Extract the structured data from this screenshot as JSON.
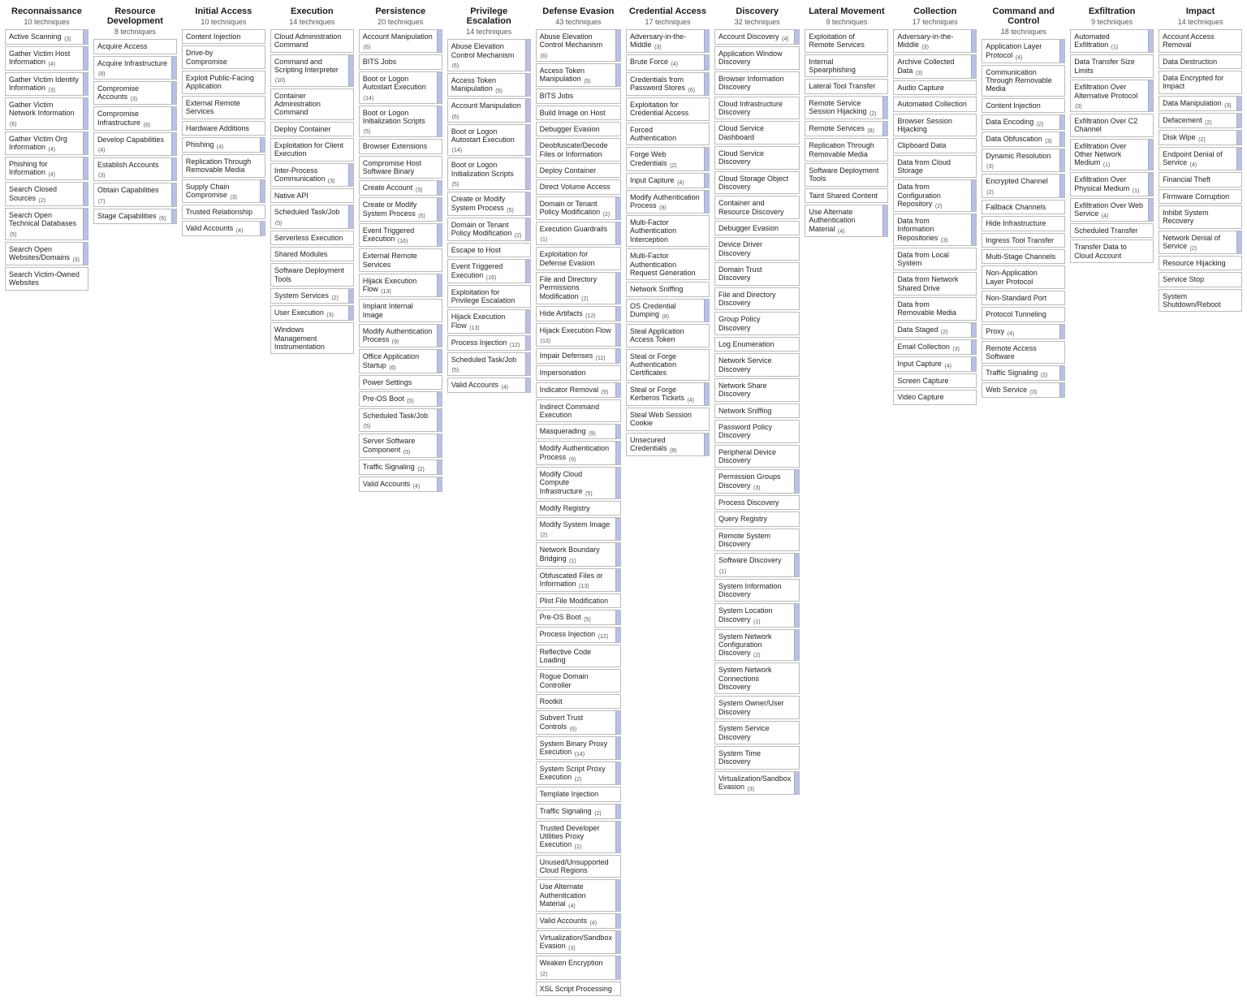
{
  "tactics": [
    {
      "name": "Reconnaissance",
      "count": 10,
      "techniques": [
        {
          "label": "Active Scanning",
          "sub": 3
        },
        {
          "label": "Gather Victim Host Information",
          "sub": 4
        },
        {
          "label": "Gather Victim Identity Information",
          "sub": 3
        },
        {
          "label": "Gather Victim Network Information",
          "sub": 6
        },
        {
          "label": "Gather Victim Org Information",
          "sub": 4
        },
        {
          "label": "Phishing for Information",
          "sub": 4
        },
        {
          "label": "Search Closed Sources",
          "sub": 2
        },
        {
          "label": "Search Open Technical Databases",
          "sub": 5
        },
        {
          "label": "Search Open Websites/Domains",
          "sub": 3
        },
        {
          "label": "Search Victim-Owned Websites"
        }
      ]
    },
    {
      "name": "Resource Development",
      "count": 8,
      "techniques": [
        {
          "label": "Acquire Access"
        },
        {
          "label": "Acquire Infrastructure",
          "sub": 8
        },
        {
          "label": "Compromise Accounts",
          "sub": 3
        },
        {
          "label": "Compromise Infrastructure",
          "sub": 8
        },
        {
          "label": "Develop Capabilities",
          "sub": 4
        },
        {
          "label": "Establish Accounts",
          "sub": 3
        },
        {
          "label": "Obtain Capabilities",
          "sub": 7
        },
        {
          "label": "Stage Capabilities",
          "sub": 6
        }
      ]
    },
    {
      "name": "Initial Access",
      "count": 10,
      "techniques": [
        {
          "label": "Content Injection"
        },
        {
          "label": "Drive-by Compromise"
        },
        {
          "label": "Exploit Public-Facing Application"
        },
        {
          "label": "External Remote Services"
        },
        {
          "label": "Hardware Additions"
        },
        {
          "label": "Phishing",
          "sub": 4
        },
        {
          "label": "Replication Through Removable Media"
        },
        {
          "label": "Supply Chain Compromise",
          "sub": 3
        },
        {
          "label": "Trusted Relationship"
        },
        {
          "label": "Valid Accounts",
          "sub": 4
        }
      ]
    },
    {
      "name": "Execution",
      "count": 14,
      "techniques": [
        {
          "label": "Cloud Administration Command"
        },
        {
          "label": "Command and Scripting Interpreter",
          "sub": 10
        },
        {
          "label": "Container Administration Command"
        },
        {
          "label": "Deploy Container"
        },
        {
          "label": "Exploitation for Client Execution"
        },
        {
          "label": "Inter-Process Communication",
          "sub": 3
        },
        {
          "label": "Native API"
        },
        {
          "label": "Scheduled Task/Job",
          "sub": 5
        },
        {
          "label": "Serverless Execution"
        },
        {
          "label": "Shared Modules"
        },
        {
          "label": "Software Deployment Tools"
        },
        {
          "label": "System Services",
          "sub": 2
        },
        {
          "label": "User Execution",
          "sub": 3
        },
        {
          "label": "Windows Management Instrumentation"
        }
      ]
    },
    {
      "name": "Persistence",
      "count": 20,
      "techniques": [
        {
          "label": "Account Manipulation",
          "sub": 6
        },
        {
          "label": "BITS Jobs"
        },
        {
          "label": "Boot or Logon Autostart Execution",
          "sub": 14
        },
        {
          "label": "Boot or Logon Initialization Scripts",
          "sub": 5
        },
        {
          "label": "Browser Extensions"
        },
        {
          "label": "Compromise Host Software Binary"
        },
        {
          "label": "Create Account",
          "sub": 3
        },
        {
          "label": "Create or Modify System Process",
          "sub": 5
        },
        {
          "label": "Event Triggered Execution",
          "sub": 16
        },
        {
          "label": "External Remote Services"
        },
        {
          "label": "Hijack Execution Flow",
          "sub": 13
        },
        {
          "label": "Implant Internal Image"
        },
        {
          "label": "Modify Authentication Process",
          "sub": 9
        },
        {
          "label": "Office Application Startup",
          "sub": 6
        },
        {
          "label": "Power Settings"
        },
        {
          "label": "Pre-OS Boot",
          "sub": 5
        },
        {
          "label": "Scheduled Task/Job",
          "sub": 5
        },
        {
          "label": "Server Software Component",
          "sub": 5
        },
        {
          "label": "Traffic Signaling",
          "sub": 2
        },
        {
          "label": "Valid Accounts",
          "sub": 4
        }
      ]
    },
    {
      "name": "Privilege Escalation",
      "count": 14,
      "techniques": [
        {
          "label": "Abuse Elevation Control Mechanism",
          "sub": 6
        },
        {
          "label": "Access Token Manipulation",
          "sub": 5
        },
        {
          "label": "Account Manipulation",
          "sub": 6
        },
        {
          "label": "Boot or Logon Autostart Execution",
          "sub": 14
        },
        {
          "label": "Boot or Logon Initialization Scripts",
          "sub": 5
        },
        {
          "label": "Create or Modify System Process",
          "sub": 5
        },
        {
          "label": "Domain or Tenant Policy Modification",
          "sub": 2
        },
        {
          "label": "Escape to Host"
        },
        {
          "label": "Event Triggered Execution",
          "sub": 16
        },
        {
          "label": "Exploitation for Privilege Escalation"
        },
        {
          "label": "Hijack Execution Flow",
          "sub": 13
        },
        {
          "label": "Process Injection",
          "sub": 12
        },
        {
          "label": "Scheduled Task/Job",
          "sub": 5
        },
        {
          "label": "Valid Accounts",
          "sub": 4
        }
      ]
    },
    {
      "name": "Defense Evasion",
      "count": 43,
      "techniques": [
        {
          "label": "Abuse Elevation Control Mechanism",
          "sub": 6
        },
        {
          "label": "Access Token Manipulation",
          "sub": 5
        },
        {
          "label": "BITS Jobs"
        },
        {
          "label": "Build Image on Host"
        },
        {
          "label": "Debugger Evasion"
        },
        {
          "label": "Deobfuscate/Decode Files or Information"
        },
        {
          "label": "Deploy Container"
        },
        {
          "label": "Direct Volume Access"
        },
        {
          "label": "Domain or Tenant Policy Modification",
          "sub": 2
        },
        {
          "label": "Execution Guardrails",
          "sub": 1
        },
        {
          "label": "Exploitation for Defense Evasion"
        },
        {
          "label": "File and Directory Permissions Modification",
          "sub": 2
        },
        {
          "label": "Hide Artifacts",
          "sub": 12
        },
        {
          "label": "Hijack Execution Flow",
          "sub": 13
        },
        {
          "label": "Impair Defenses",
          "sub": 11
        },
        {
          "label": "Impersonation"
        },
        {
          "label": "Indicator Removal",
          "sub": 9
        },
        {
          "label": "Indirect Command Execution"
        },
        {
          "label": "Masquerading",
          "sub": 9
        },
        {
          "label": "Modify Authentication Process",
          "sub": 9
        },
        {
          "label": "Modify Cloud Compute Infrastructure",
          "sub": 5
        },
        {
          "label": "Modify Registry"
        },
        {
          "label": "Modify System Image",
          "sub": 2
        },
        {
          "label": "Network Boundary Bridging",
          "sub": 1
        },
        {
          "label": "Obfuscated Files or Information",
          "sub": 13
        },
        {
          "label": "Plist File Modification"
        },
        {
          "label": "Pre-OS Boot",
          "sub": 5
        },
        {
          "label": "Process Injection",
          "sub": 12
        },
        {
          "label": "Reflective Code Loading"
        },
        {
          "label": "Rogue Domain Controller"
        },
        {
          "label": "Rootkit"
        },
        {
          "label": "Subvert Trust Controls",
          "sub": 6
        },
        {
          "label": "System Binary Proxy Execution",
          "sub": 14
        },
        {
          "label": "System Script Proxy Execution",
          "sub": 2
        },
        {
          "label": "Template Injection"
        },
        {
          "label": "Traffic Signaling",
          "sub": 2
        },
        {
          "label": "Trusted Developer Utilities Proxy Execution",
          "sub": 1
        },
        {
          "label": "Unused/Unsupported Cloud Regions"
        },
        {
          "label": "Use Alternate Authentication Material",
          "sub": 4
        },
        {
          "label": "Valid Accounts",
          "sub": 4
        },
        {
          "label": "Virtualization/Sandbox Evasion",
          "sub": 3
        },
        {
          "label": "Weaken Encryption",
          "sub": 2
        },
        {
          "label": "XSL Script Processing"
        }
      ]
    },
    {
      "name": "Credential Access",
      "count": 17,
      "techniques": [
        {
          "label": "Adversary-in-the-Middle",
          "sub": 3
        },
        {
          "label": "Brute Force",
          "sub": 4
        },
        {
          "label": "Credentials from Password Stores",
          "sub": 6
        },
        {
          "label": "Exploitation for Credential Access"
        },
        {
          "label": "Forced Authentication"
        },
        {
          "label": "Forge Web Credentials",
          "sub": 2
        },
        {
          "label": "Input Capture",
          "sub": 4
        },
        {
          "label": "Modify Authentication Process",
          "sub": 9
        },
        {
          "label": "Multi-Factor Authentication Interception"
        },
        {
          "label": "Multi-Factor Authentication Request Generation"
        },
        {
          "label": "Network Sniffing"
        },
        {
          "label": "OS Credential Dumping",
          "sub": 8
        },
        {
          "label": "Steal Application Access Token"
        },
        {
          "label": "Steal or Forge Authentication Certificates"
        },
        {
          "label": "Steal or Forge Kerberos Tickets",
          "sub": 4
        },
        {
          "label": "Steal Web Session Cookie"
        },
        {
          "label": "Unsecured Credentials",
          "sub": 8
        }
      ]
    },
    {
      "name": "Discovery",
      "count": 32,
      "techniques": [
        {
          "label": "Account Discovery",
          "sub": 4
        },
        {
          "label": "Application Window Discovery"
        },
        {
          "label": "Browser Information Discovery"
        },
        {
          "label": "Cloud Infrastructure Discovery"
        },
        {
          "label": "Cloud Service Dashboard"
        },
        {
          "label": "Cloud Service Discovery"
        },
        {
          "label": "Cloud Storage Object Discovery"
        },
        {
          "label": "Container and Resource Discovery"
        },
        {
          "label": "Debugger Evasion"
        },
        {
          "label": "Device Driver Discovery"
        },
        {
          "label": "Domain Trust Discovery"
        },
        {
          "label": "File and Directory Discovery"
        },
        {
          "label": "Group Policy Discovery"
        },
        {
          "label": "Log Enumeration"
        },
        {
          "label": "Network Service Discovery"
        },
        {
          "label": "Network Share Discovery"
        },
        {
          "label": "Network Sniffing"
        },
        {
          "label": "Password Policy Discovery"
        },
        {
          "label": "Peripheral Device Discovery"
        },
        {
          "label": "Permission Groups Discovery",
          "sub": 3
        },
        {
          "label": "Process Discovery"
        },
        {
          "label": "Query Registry"
        },
        {
          "label": "Remote System Discovery"
        },
        {
          "label": "Software Discovery",
          "sub": 1
        },
        {
          "label": "System Information Discovery"
        },
        {
          "label": "System Location Discovery",
          "sub": 1
        },
        {
          "label": "System Network Configuration Discovery",
          "sub": 2
        },
        {
          "label": "System Network Connections Discovery"
        },
        {
          "label": "System Owner/User Discovery"
        },
        {
          "label": "System Service Discovery"
        },
        {
          "label": "System Time Discovery"
        },
        {
          "label": "Virtualization/Sandbox Evasion",
          "sub": 3
        }
      ]
    },
    {
      "name": "Lateral Movement",
      "count": 9,
      "techniques": [
        {
          "label": "Exploitation of Remote Services"
        },
        {
          "label": "Internal Spearphishing"
        },
        {
          "label": "Lateral Tool Transfer"
        },
        {
          "label": "Remote Service Session Hijacking",
          "sub": 2
        },
        {
          "label": "Remote Services",
          "sub": 8
        },
        {
          "label": "Replication Through Removable Media"
        },
        {
          "label": "Software Deployment Tools"
        },
        {
          "label": "Taint Shared Content"
        },
        {
          "label": "Use Alternate Authentication Material",
          "sub": 4
        }
      ]
    },
    {
      "name": "Collection",
      "count": 17,
      "techniques": [
        {
          "label": "Adversary-in-the-Middle",
          "sub": 3
        },
        {
          "label": "Archive Collected Data",
          "sub": 3
        },
        {
          "label": "Audio Capture"
        },
        {
          "label": "Automated Collection"
        },
        {
          "label": "Browser Session Hijacking"
        },
        {
          "label": "Clipboard Data"
        },
        {
          "label": "Data from Cloud Storage"
        },
        {
          "label": "Data from Configuration Repository",
          "sub": 2
        },
        {
          "label": "Data from Information Repositories",
          "sub": 3
        },
        {
          "label": "Data from Local System"
        },
        {
          "label": "Data from Network Shared Drive"
        },
        {
          "label": "Data from Removable Media"
        },
        {
          "label": "Data Staged",
          "sub": 2
        },
        {
          "label": "Email Collection",
          "sub": 3
        },
        {
          "label": "Input Capture",
          "sub": 4
        },
        {
          "label": "Screen Capture"
        },
        {
          "label": "Video Capture"
        }
      ]
    },
    {
      "name": "Command and Control",
      "count": 18,
      "techniques": [
        {
          "label": "Application Layer Protocol",
          "sub": 4
        },
        {
          "label": "Communication Through Removable Media"
        },
        {
          "label": "Content Injection"
        },
        {
          "label": "Data Encoding",
          "sub": 2
        },
        {
          "label": "Data Obfuscation",
          "sub": 3
        },
        {
          "label": "Dynamic Resolution",
          "sub": 3
        },
        {
          "label": "Encrypted Channel",
          "sub": 2
        },
        {
          "label": "Fallback Channels"
        },
        {
          "label": "Hide Infrastructure"
        },
        {
          "label": "Ingress Tool Transfer"
        },
        {
          "label": "Multi-Stage Channels"
        },
        {
          "label": "Non-Application Layer Protocol"
        },
        {
          "label": "Non-Standard Port"
        },
        {
          "label": "Protocol Tunneling"
        },
        {
          "label": "Proxy",
          "sub": 4
        },
        {
          "label": "Remote Access Software"
        },
        {
          "label": "Traffic Signaling",
          "sub": 2
        },
        {
          "label": "Web Service",
          "sub": 3
        }
      ]
    },
    {
      "name": "Exfiltration",
      "count": 9,
      "techniques": [
        {
          "label": "Automated Exfiltration",
          "sub": 1
        },
        {
          "label": "Data Transfer Size Limits"
        },
        {
          "label": "Exfiltration Over Alternative Protocol",
          "sub": 3
        },
        {
          "label": "Exfiltration Over C2 Channel"
        },
        {
          "label": "Exfiltration Over Other Network Medium",
          "sub": 1
        },
        {
          "label": "Exfiltration Over Physical Medium",
          "sub": 1
        },
        {
          "label": "Exfiltration Over Web Service",
          "sub": 4
        },
        {
          "label": "Scheduled Transfer"
        },
        {
          "label": "Transfer Data to Cloud Account"
        }
      ]
    },
    {
      "name": "Impact",
      "count": 14,
      "techniques": [
        {
          "label": "Account Access Removal"
        },
        {
          "label": "Data Destruction"
        },
        {
          "label": "Data Encrypted for Impact"
        },
        {
          "label": "Data Manipulation",
          "sub": 3
        },
        {
          "label": "Defacement",
          "sub": 2
        },
        {
          "label": "Disk Wipe",
          "sub": 2
        },
        {
          "label": "Endpoint Denial of Service",
          "sub": 4
        },
        {
          "label": "Financial Theft"
        },
        {
          "label": "Firmware Corruption"
        },
        {
          "label": "Inhibit System Recovery"
        },
        {
          "label": "Network Denial of Service",
          "sub": 2
        },
        {
          "label": "Resource Hijacking"
        },
        {
          "label": "Service Stop"
        },
        {
          "label": "System Shutdown/Reboot"
        }
      ]
    }
  ],
  "sub_suffix": " techniques"
}
